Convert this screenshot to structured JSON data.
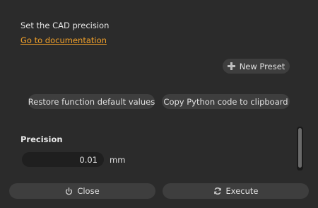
{
  "description": "Set the CAD precision",
  "documentation_link": "Go to documentation",
  "buttons": {
    "new_preset": "New Preset",
    "restore_defaults": "Restore function default values",
    "copy_python": "Copy Python code to clipboard",
    "close": "Close",
    "execute": "Execute"
  },
  "precision": {
    "title": "Precision",
    "value": "0.01",
    "unit": "mm"
  },
  "icons": {
    "new_preset": "plus-icon",
    "close": "power-icon",
    "execute": "refresh-icon"
  }
}
